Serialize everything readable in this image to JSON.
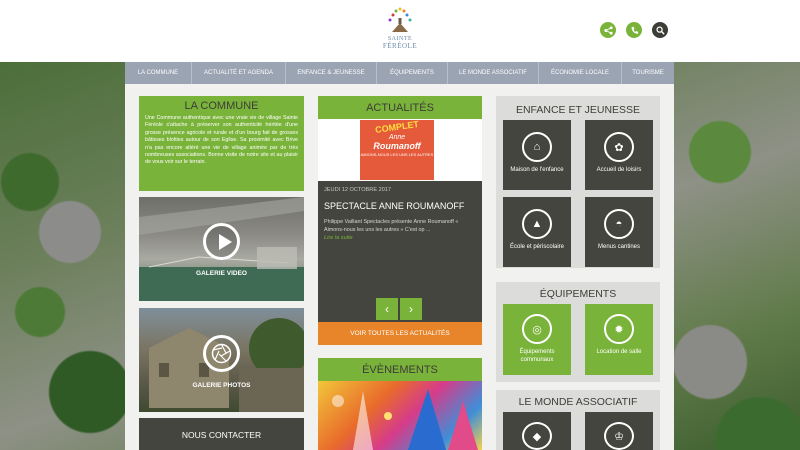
{
  "header": {
    "logo_line1": "SAINTE",
    "logo_line2": "FÉRÉOLE",
    "icons": [
      "share-icon",
      "phone-icon",
      "search-icon"
    ]
  },
  "nav": {
    "items": [
      {
        "label": "La Commune"
      },
      {
        "label": "Actualité et agenda"
      },
      {
        "label": "Enfance & jeunesse"
      },
      {
        "label": "Équipements"
      },
      {
        "label": "Le monde associatif"
      },
      {
        "label": "Économie locale"
      },
      {
        "label": "Tourisme"
      }
    ]
  },
  "commune": {
    "title": "LA COMMUNE",
    "text": "Une Commune authentique avec une vraie vie de village Sainte Féréole s'attache à préserver son authenticité héritée d'une grosse présence agricole et rurale et d'un bourg fait de grosses bâtisses blotties autour de son Eglise. Sa proximité avec Brive n'a pas encore altéré une vie de village animée par de très nombreuses associations. Bonne visite de notre site et au plaisir de vous voir sur le terrain."
  },
  "gallery": {
    "video_label": "GALERIE VIDEO",
    "photo_label": "GALERIE PHOTOS"
  },
  "contact": {
    "title": "NOUS CONTACTER"
  },
  "actualites": {
    "title": "ACTUALITÉS",
    "poster": {
      "stamp": "COMPLET",
      "name_first": "Anne",
      "name_last": "Roumanoff",
      "tagline": "AIMONS-NOUS LES UNS LES AUTRES"
    },
    "date": "JEUDI 12 OCTOBRE 2017",
    "headline": "SPECTACLE ANNE ROUMANOFF",
    "excerpt": "Philippe Vaillant Spectacles présente Anne Roumanoff « Aimons-nous les uns les autres » C'est op ...",
    "read_more": "Lire la suite",
    "all_link": "VOIR TOUTES LES ACTUALITÉS",
    "prev": "‹",
    "next": "›"
  },
  "evenements": {
    "title": "ÉVÈNEMENTS"
  },
  "enfance": {
    "title": "ENFANCE ET JEUNESSE",
    "tiles": [
      {
        "label": "Maison de l'enfance",
        "icon": "house-icon"
      },
      {
        "label": "Accueil de loisirs",
        "icon": "leisure-icon"
      },
      {
        "label": "École et périscolaire",
        "icon": "school-icon"
      },
      {
        "label": "Menus cantines",
        "icon": "cloche-icon"
      }
    ]
  },
  "equipements": {
    "title": "ÉQUIPEMENTS",
    "tiles": [
      {
        "label": "Équipements communaux",
        "icon": "hat-icon"
      },
      {
        "label": "Location de salle",
        "icon": "gear-icon"
      }
    ]
  },
  "associatif": {
    "title": "LE MONDE ASSOCIATIF",
    "tiles": [
      {
        "label": "",
        "icon": "diamond-icon"
      },
      {
        "label": "",
        "icon": "trophy-icon"
      }
    ]
  },
  "colors": {
    "green": "#7ab33a",
    "dark": "#45453f",
    "orange": "#e8852b",
    "nav": "#9aa4b2"
  }
}
